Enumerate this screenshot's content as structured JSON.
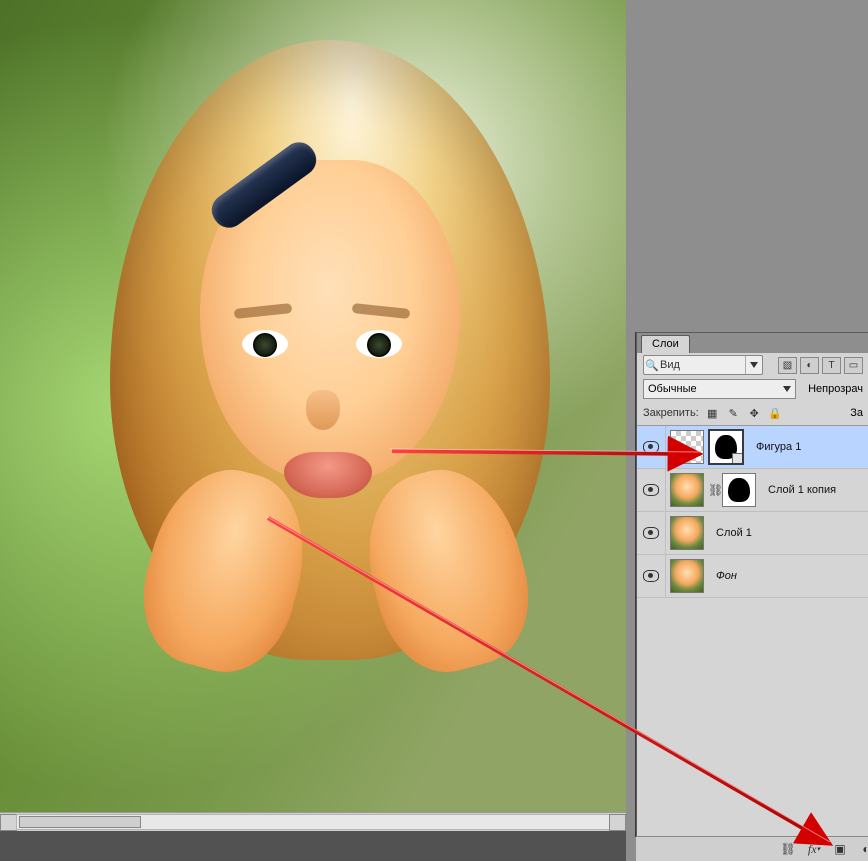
{
  "panel": {
    "tab_label": "Слои",
    "filter_kind_label": "Вид",
    "blend_mode": "Обычные",
    "opacity_label": "Непрозрач",
    "lock_label": "Закрепить:",
    "fill_label_partial": "За"
  },
  "kind_filter_icons": [
    "image-icon",
    "adjustment-icon",
    "type-icon",
    "shape-icon",
    "smartobj-icon"
  ],
  "lock_icons": [
    "lock-pixels-icon",
    "lock-brush-icon",
    "lock-position-icon",
    "lock-all-icon"
  ],
  "layers": [
    {
      "name": "Фигура 1",
      "visible": true,
      "selected": true,
      "thumb": "checker",
      "mask": "silhouette_vec",
      "italic": false
    },
    {
      "name": "Слой 1 копия",
      "visible": true,
      "selected": false,
      "thumb": "photo",
      "link": true,
      "mask": "silhouette",
      "italic": false
    },
    {
      "name": "Слой 1",
      "visible": true,
      "selected": false,
      "thumb": "photo",
      "italic": false
    },
    {
      "name": "Фон",
      "visible": true,
      "selected": false,
      "thumb": "photo",
      "italic": true
    }
  ],
  "bottom_icons": [
    "link-icon",
    "fx-icon",
    "mask-icon",
    "adjustment-icon",
    "group-icon",
    "new-layer-icon",
    "trash-icon"
  ]
}
